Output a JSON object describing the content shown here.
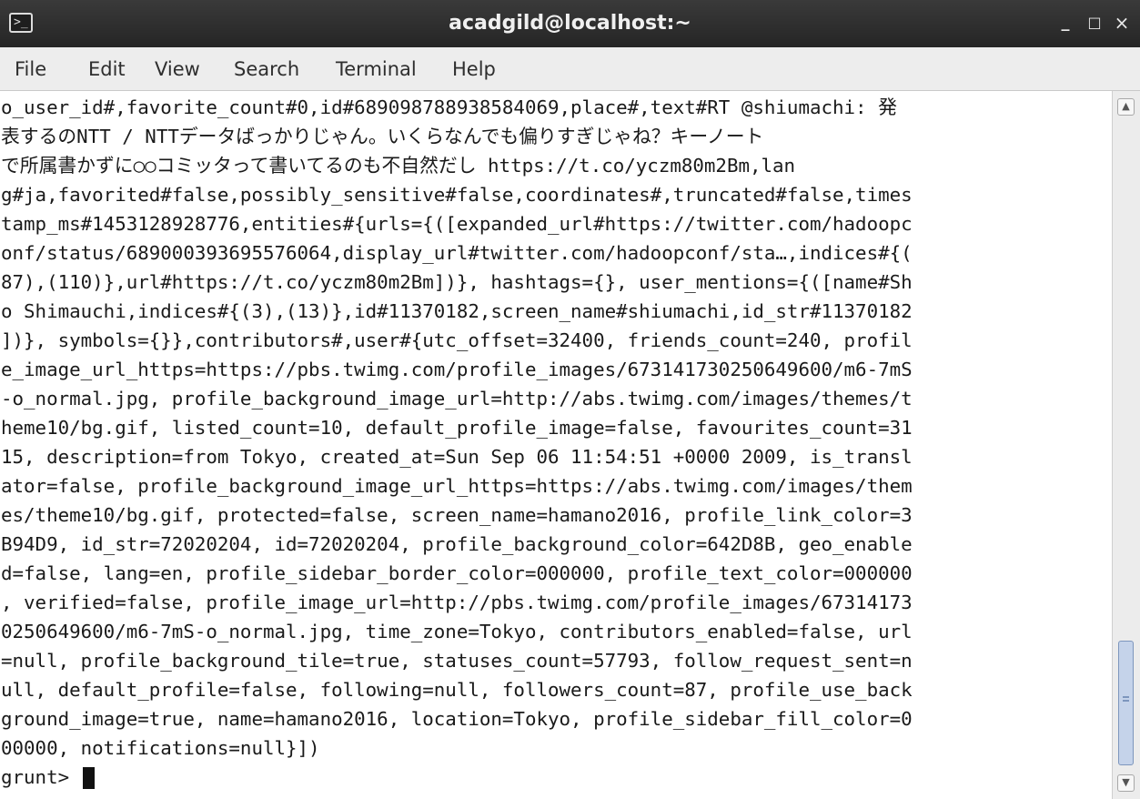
{
  "window": {
    "title": "acadgild@localhost:~",
    "controls": {
      "minimize": "_",
      "maximize": "□",
      "close": "×"
    }
  },
  "menu": {
    "file": "File",
    "edit": "Edit",
    "view": "View",
    "search": "Search",
    "terminal": "Terminal",
    "help": "Help"
  },
  "terminal": {
    "lines": [
      "o_user_id#,favorite_count#0,id#689098788938584069,place#,text#RT @shiumachi: 発",
      "表するのNTT / NTTデータばっかりじゃん。いくらなんでも偏りすぎじゃね？キーノート",
      "で所属書かずに○○コミッタって書いてるのも不自然だし https://t.co/yczm80m2Bm,lan",
      "g#ja,favorited#false,possibly_sensitive#false,coordinates#,truncated#false,times",
      "tamp_ms#1453128928776,entities#{urls={([expanded_url#https://twitter.com/hadoopc",
      "onf/status/689000393695576064,display_url#twitter.com/hadoopconf/sta…,indices#{(",
      "87),(110)},url#https://t.co/yczm80m2Bm])}, hashtags={}, user_mentions={([name#Sh",
      "o Shimauchi,indices#{(3),(13)},id#11370182,screen_name#shiumachi,id_str#11370182",
      "])}, symbols={}},contributors#,user#{utc_offset=32400, friends_count=240, profil",
      "e_image_url_https=https://pbs.twimg.com/profile_images/673141730250649600/m6-7mS",
      "-o_normal.jpg, profile_background_image_url=http://abs.twimg.com/images/themes/t",
      "heme10/bg.gif, listed_count=10, default_profile_image=false, favourites_count=31",
      "15, description=from Tokyo, created_at=Sun Sep 06 11:54:51 +0000 2009, is_transl",
      "ator=false, profile_background_image_url_https=https://abs.twimg.com/images/them",
      "es/theme10/bg.gif, protected=false, screen_name=hamano2016, profile_link_color=3",
      "B94D9, id_str=72020204, id=72020204, profile_background_color=642D8B, geo_enable",
      "d=false, lang=en, profile_sidebar_border_color=000000, profile_text_color=000000",
      ", verified=false, profile_image_url=http://pbs.twimg.com/profile_images/67314173",
      "0250649600/m6-7mS-o_normal.jpg, time_zone=Tokyo, contributors_enabled=false, url",
      "=null, profile_background_tile=true, statuses_count=57793, follow_request_sent=n",
      "ull, default_profile=false, following=null, followers_count=87, profile_use_back",
      "ground_image=true, name=hamano2016, location=Tokyo, profile_sidebar_fill_color=0",
      "00000, notifications=null}])"
    ],
    "prompt": "grunt> "
  },
  "icons": {
    "app": "terminal-icon",
    "scroll_up": "chevron-up-icon",
    "scroll_down": "chevron-down-icon"
  },
  "colors": {
    "titlebar": "#2b2b2b",
    "menubar": "#ededed",
    "terminal_bg": "#ffffff",
    "terminal_fg": "#1a1a1a",
    "scroll_thumb": "#c5d3ea"
  }
}
